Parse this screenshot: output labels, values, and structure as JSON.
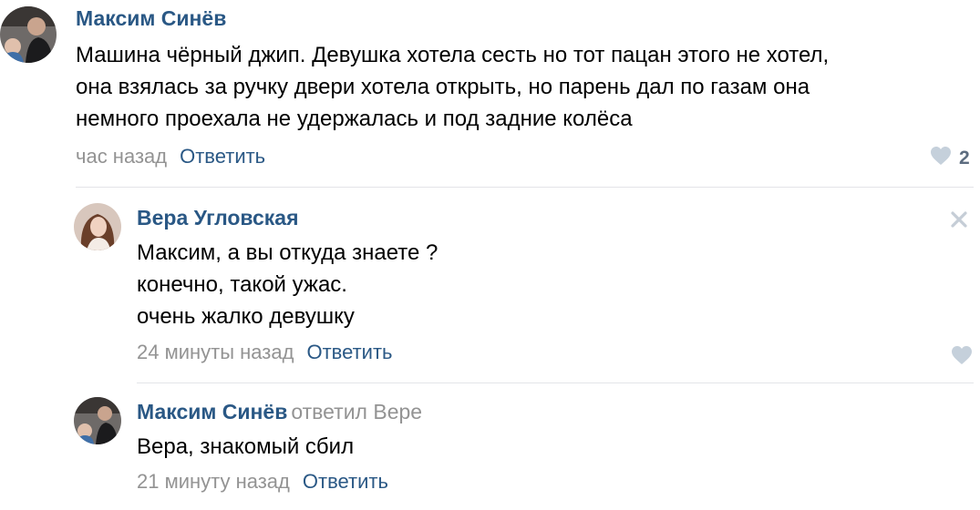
{
  "comments": [
    {
      "author": "Максим Синёв",
      "reply_to": "",
      "lines": [
        "Машина чёрный джип. Девушка хотела сесть но тот пацан этого не хотел,",
        "она взялась за ручку двери хотела открыть, но парень дал по газам она",
        "немного проехала не удержалась и под задние колёса"
      ],
      "time": "час назад",
      "reply_label": "Ответить",
      "likes": "2"
    },
    {
      "author": "Вера Угловская",
      "reply_to": "",
      "lines": [
        "Максим, а вы откуда знаете ?",
        "конечно, такой ужас.",
        "очень жалко девушку"
      ],
      "time": "24 минуты назад",
      "reply_label": "Ответить",
      "likes": ""
    },
    {
      "author": "Максим Синёв",
      "reply_to": "ответил Вере",
      "lines": [
        "Вера, знакомый сбил"
      ],
      "time": "21 минуту назад",
      "reply_label": "Ответить",
      "likes": ""
    }
  ],
  "colors": {
    "link": "#2a5885",
    "muted": "#939393",
    "like_icon": "#c5d0db",
    "divider": "#e3e4e8"
  },
  "icons": {
    "like": "heart-icon",
    "delete": "close-icon"
  }
}
